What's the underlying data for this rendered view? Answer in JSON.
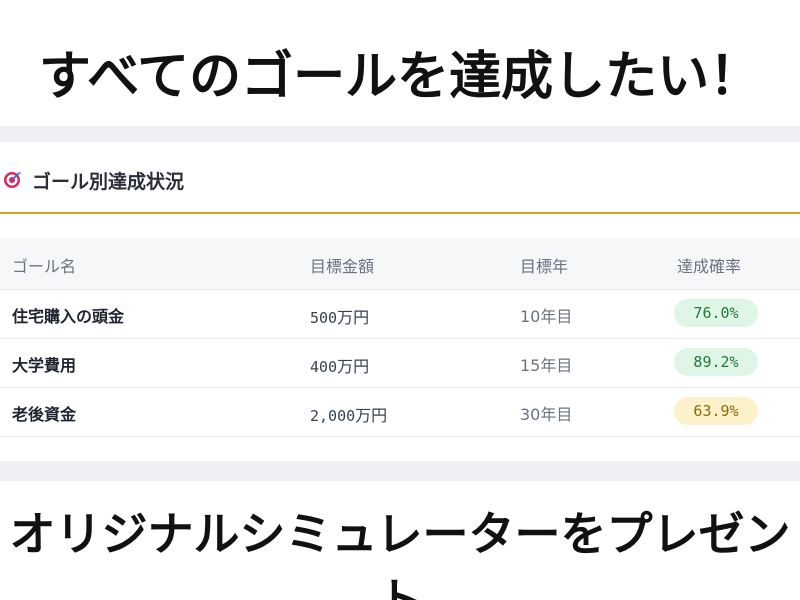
{
  "headline": "すべてのゴールを達成したい！",
  "card": {
    "title": "ゴール別達成状況",
    "icon": "target-icon"
  },
  "table": {
    "columns": [
      "ゴール名",
      "目標金額",
      "目標年",
      "達成確率"
    ],
    "rows": [
      {
        "name": "住宅購入の頭金",
        "amount_num": "500",
        "amount_unit": "万円",
        "year": "10年目",
        "probability": "76.0%",
        "status_color": "#dff5e6"
      },
      {
        "name": "大学費用",
        "amount_num": "400",
        "amount_unit": "万円",
        "year": "15年目",
        "probability": "89.2%",
        "status_color": "#dff5e6"
      },
      {
        "name": "老後資金",
        "amount_num": "2,000",
        "amount_unit": "万円",
        "year": "30年目",
        "probability": "63.9%",
        "status_color": "#fdf1cc"
      }
    ]
  },
  "footer": "オリジナルシミュレーターをプレゼント",
  "colors": {
    "accent_line": "#c9a227",
    "band": "#eff0f3",
    "pill_green": "#dff5e6",
    "pill_yellow": "#fdf1cc"
  }
}
